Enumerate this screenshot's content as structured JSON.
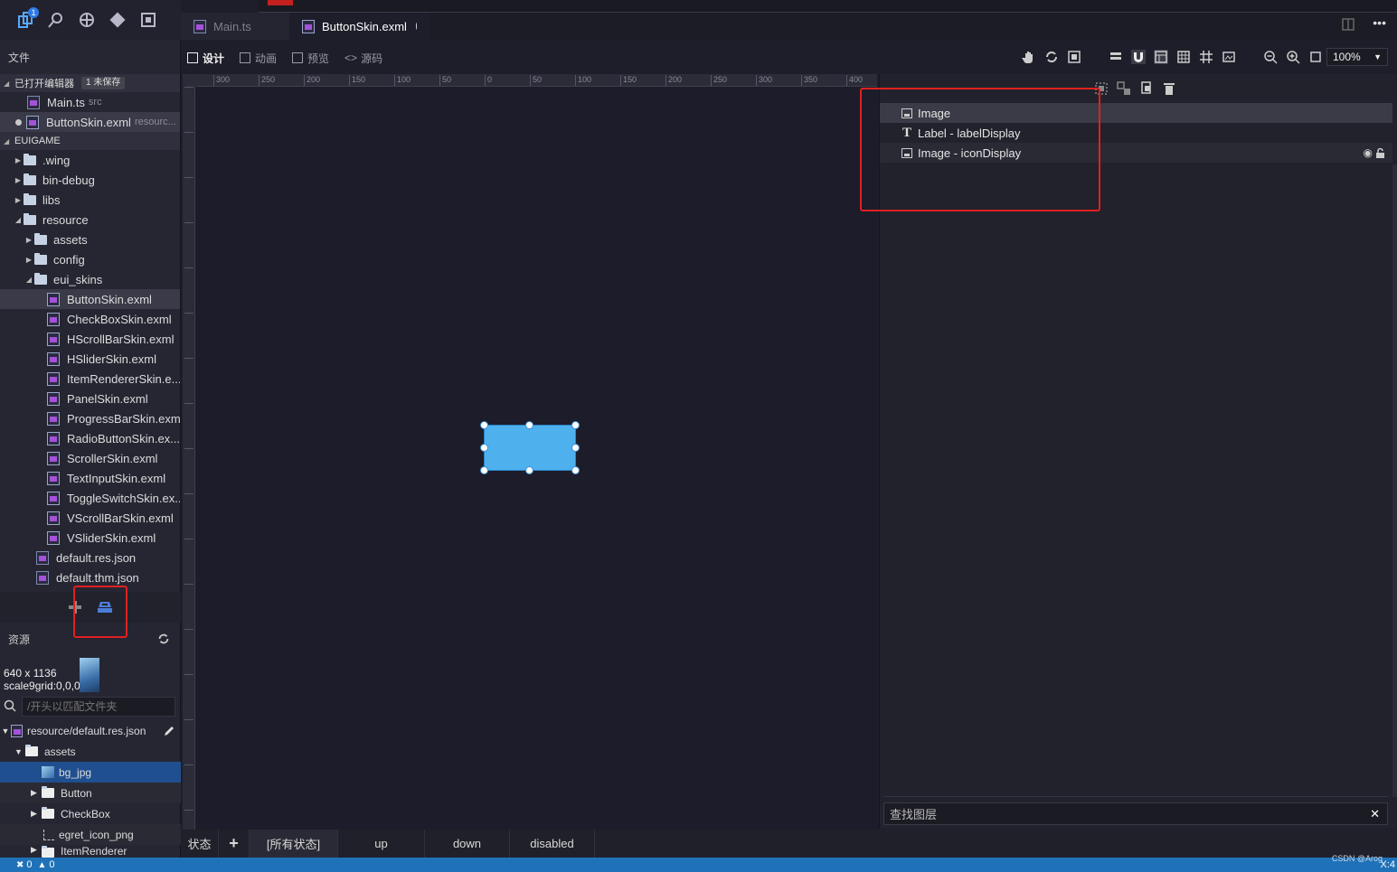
{
  "tabs": {
    "main": "Main.ts",
    "skin": "ButtonSkin.exml"
  },
  "activity": {
    "badge": "1"
  },
  "sidebar": {
    "files_title": "文件",
    "open_editors": "已打开编辑器",
    "unsaved": "1 未保存",
    "open_files": [
      {
        "name": "Main.ts",
        "sub": "src"
      },
      {
        "name": "ButtonSkin.exml",
        "sub": "resourc..."
      }
    ],
    "project": "EUIGAME",
    "tree": [
      ".wing",
      "bin-debug",
      "libs",
      "resource",
      "assets",
      "config",
      "eui_skins",
      "ButtonSkin.exml",
      "CheckBoxSkin.exml",
      "HScrollBarSkin.exml",
      "HSliderSkin.exml",
      "ItemRendererSkin.e...",
      "PanelSkin.exml",
      "ProgressBarSkin.exml",
      "RadioButtonSkin.ex...",
      "ScrollerSkin.exml",
      "TextInputSkin.exml",
      "ToggleSwitchSkin.ex...",
      "VScrollBarSkin.exml",
      "VSliderSkin.exml",
      "default.res.json",
      "default.thm.json"
    ]
  },
  "resources": {
    "title": "资源",
    "size": "640 x 1136",
    "scale9": "scale9grid:0,0,0,0",
    "search_placeholder": "/开头以匹配文件夹",
    "items": [
      "resource/default.res.json",
      "assets",
      "bg_jpg",
      "Button",
      "CheckBox",
      "egret_icon_png",
      "ItemRenderer"
    ]
  },
  "toolbar": {
    "design": "设计",
    "animation": "动画",
    "preview": "预览",
    "source": "源码",
    "zoom": "100%"
  },
  "ruler": {
    "h_ticks": [
      "300",
      "250",
      "200",
      "150",
      "100",
      "50",
      "0",
      "50",
      "100",
      "150",
      "200",
      "250",
      "300",
      "350",
      "400"
    ]
  },
  "layers": {
    "items": [
      {
        "icon": "image",
        "label": "Image"
      },
      {
        "icon": "text",
        "label": "Label - labelDisplay"
      },
      {
        "icon": "image",
        "label": "Image - iconDisplay"
      }
    ],
    "search_placeholder": "查找图层"
  },
  "states": {
    "label": "状态",
    "items": [
      "[所有状态]",
      "up",
      "down",
      "disabled"
    ]
  },
  "status": {
    "errors": "0",
    "warnings": "0",
    "right": "X:4"
  },
  "watermark": "CSDN @Arog",
  "colors": {
    "accent": "#1f72b8",
    "selection_shape": "#4fb0ee",
    "annotation": "#e02020"
  }
}
